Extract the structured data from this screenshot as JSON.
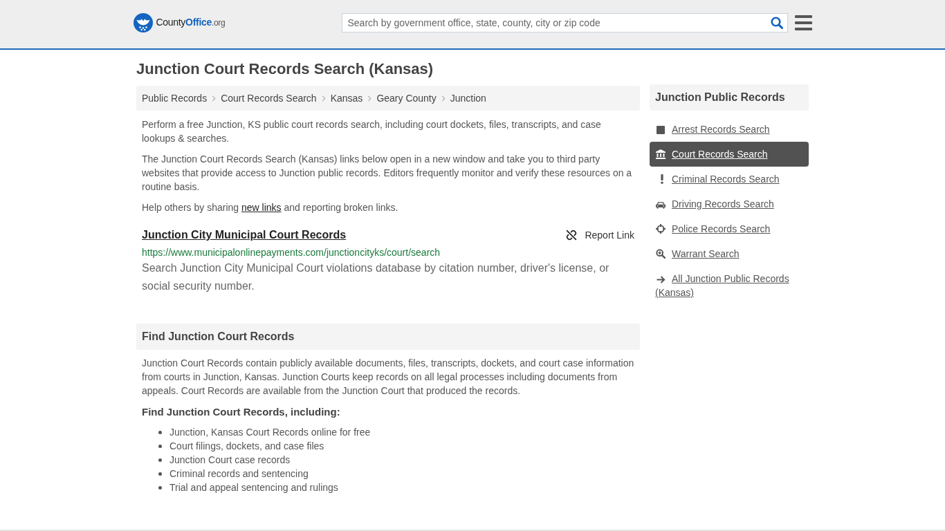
{
  "header": {
    "logo": {
      "text_1": "County",
      "text_2": "Office",
      "text_3": ".org"
    },
    "search": {
      "placeholder": "Search by government office, state, county, city or zip code"
    }
  },
  "page_title": "Junction Court Records Search (Kansas)",
  "breadcrumbs": [
    "Public Records",
    "Court Records Search",
    "Kansas",
    "Geary County",
    "Junction"
  ],
  "intro": {
    "paragraphs": [
      "Perform a free Junction, KS public court records search, including court dockets, files, transcripts, and case lookups & searches.",
      "The Junction Court Records Search (Kansas) links below open in a new window and take you to third party websites that provide access to Junction public records. Editors frequently monitor and verify these resources on a routine basis."
    ],
    "help": {
      "before": "Help others by sharing ",
      "link": "new links",
      "after": " and reporting broken links."
    }
  },
  "results": [
    {
      "title": "Junction City Municipal Court Records",
      "report_label": "Report Link",
      "url": "https://www.municipalonlinepayments.com/junctioncityks/court/search",
      "description": "Search Junction City Municipal Court violations database by citation number, driver's license, or social security number."
    }
  ],
  "find_section": {
    "heading": "Find Junction Court Records",
    "text": "Junction Court Records contain publicly available documents, files, transcripts, dockets, and court case information from courts in Junction, Kansas. Junction Courts keep records on all legal processes including documents from appeals. Court Records are available from the Junction Court that produced the records.",
    "subheading": "Find Junction Court Records, including:",
    "items": [
      "Junction, Kansas Court Records online for free",
      "Court filings, dockets, and case files",
      "Junction Court case records",
      "Criminal records and sentencing",
      "Trial and appeal sentencing and rulings"
    ]
  },
  "sidebar": {
    "heading": "Junction Public Records",
    "items": [
      {
        "label": "Arrest Records Search",
        "kind": "square",
        "selected": false
      },
      {
        "label": "Court Records Search",
        "kind": "columns",
        "selected": true
      },
      {
        "label": "Criminal Records Search",
        "kind": "exclamation",
        "selected": false
      },
      {
        "label": "Driving Records Search",
        "kind": "car",
        "selected": false
      },
      {
        "label": "Police Records Search",
        "kind": "crosshair",
        "selected": false
      },
      {
        "label": "Warrant Search",
        "kind": "zoom",
        "selected": false
      },
      {
        "label": "All Junction Public Records (Kansas)",
        "kind": "arrow",
        "selected": false
      }
    ]
  }
}
